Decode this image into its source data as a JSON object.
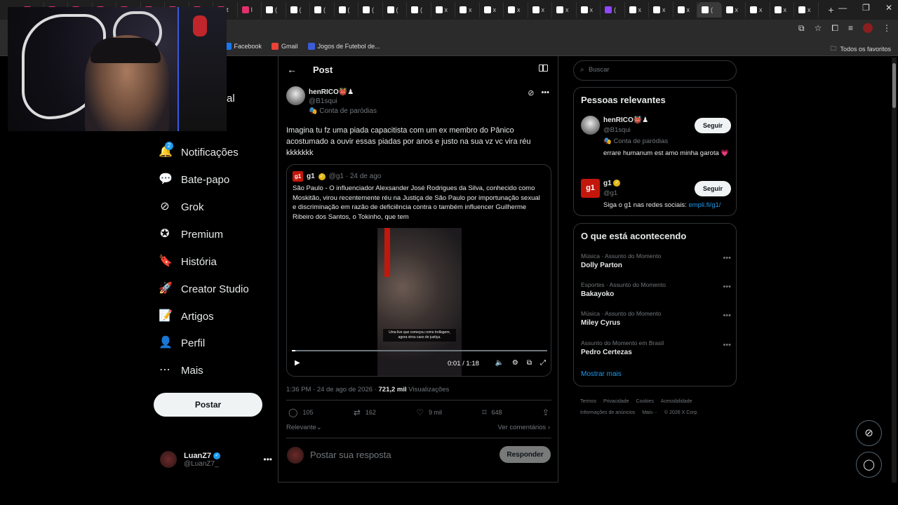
{
  "browser": {
    "tabs": [
      {
        "label": "t",
        "icon": "instagram-icon",
        "color": "#e1306c"
      },
      {
        "label": "t",
        "icon": "instagram-icon",
        "color": "#e1306c"
      },
      {
        "label": "t",
        "icon": "instagram-icon",
        "color": "#e1306c"
      },
      {
        "label": "t",
        "icon": "instagram-icon",
        "color": "#e1306c"
      },
      {
        "label": "t",
        "icon": "instagram-icon",
        "color": "#e1306c"
      },
      {
        "label": "t",
        "icon": "instagram-icon",
        "color": "#e1306c"
      },
      {
        "label": "t",
        "icon": "instagram-icon",
        "color": "#e1306c"
      },
      {
        "label": "t",
        "icon": "instagram-icon",
        "color": "#e1306c"
      },
      {
        "label": "t",
        "icon": "instagram-icon",
        "color": "#e1306c"
      },
      {
        "label": "I",
        "icon": "instagram-icon",
        "color": "#e1306c"
      },
      {
        "label": "(",
        "icon": "tiktok-icon",
        "color": "#ffffff"
      },
      {
        "label": "(",
        "icon": "tiktok-icon",
        "color": "#ffffff"
      },
      {
        "label": "(",
        "icon": "tiktok-icon",
        "color": "#ffffff"
      },
      {
        "label": "(",
        "icon": "tiktok-icon",
        "color": "#ffffff"
      },
      {
        "label": "(",
        "icon": "tiktok-icon",
        "color": "#ffffff"
      },
      {
        "label": "(",
        "icon": "tiktok-icon",
        "color": "#ffffff"
      },
      {
        "label": "(",
        "icon": "tiktok-icon",
        "color": "#ffffff"
      },
      {
        "label": "x",
        "icon": "x-icon",
        "color": "#ffffff"
      },
      {
        "label": "x",
        "icon": "x-icon",
        "color": "#ffffff"
      },
      {
        "label": "x",
        "icon": "x-icon",
        "color": "#ffffff"
      },
      {
        "label": "x",
        "icon": "x-icon",
        "color": "#ffffff"
      },
      {
        "label": "x",
        "icon": "x-icon",
        "color": "#ffffff"
      },
      {
        "label": "x",
        "icon": "x-icon",
        "color": "#ffffff"
      },
      {
        "label": "x",
        "icon": "x-icon",
        "color": "#ffffff"
      },
      {
        "label": "(",
        "icon": "twitch-icon",
        "color": "#9146ff"
      },
      {
        "label": "x",
        "icon": "x-icon",
        "color": "#ffffff"
      },
      {
        "label": "x",
        "icon": "x-icon",
        "color": "#ffffff"
      },
      {
        "label": "x",
        "icon": "x-icon",
        "color": "#ffffff"
      },
      {
        "label": "(",
        "icon": "x-icon",
        "color": "#ffffff",
        "active": true
      },
      {
        "label": "x",
        "icon": "x-icon",
        "color": "#ffffff"
      },
      {
        "label": "x",
        "icon": "x-icon",
        "color": "#ffffff"
      },
      {
        "label": "x",
        "icon": "x-icon",
        "color": "#ffffff"
      },
      {
        "label": "x",
        "icon": "x-icon",
        "color": "#ffffff"
      }
    ],
    "new_tab": "+",
    "bookmarks": [
      {
        "label": "ok",
        "color": "#1877f2"
      },
      {
        "label": "Facebook",
        "color": "#1877f2"
      },
      {
        "label": "Gmail",
        "color": "#ea4335"
      },
      {
        "label": "Jogos de Futebol de...",
        "color": "#3b5bdb"
      }
    ],
    "all_bookmarks": "Todos os favoritos"
  },
  "nav": {
    "partial_label": "al",
    "items": [
      {
        "label": "Notificações",
        "icon": "bell-icon",
        "glyph": "🔔",
        "badge": "2"
      },
      {
        "label": "Bate-papo",
        "icon": "chat-icon",
        "glyph": "💬"
      },
      {
        "label": "Grok",
        "icon": "grok-icon",
        "glyph": "⊘"
      },
      {
        "label": "Premium",
        "icon": "premium-icon",
        "glyph": "✪"
      },
      {
        "label": "História",
        "icon": "bookmark-icon",
        "glyph": "🔖"
      },
      {
        "label": "Creator Studio",
        "icon": "rocket-icon",
        "glyph": "🚀"
      },
      {
        "label": "Artigos",
        "icon": "article-icon",
        "glyph": "📝"
      },
      {
        "label": "Perfil",
        "icon": "person-icon",
        "glyph": "👤"
      },
      {
        "label": "Mais",
        "icon": "more-circle-icon",
        "glyph": "⋯"
      }
    ],
    "post_button": "Postar",
    "me": {
      "name": "LuanZ7",
      "handle": "@LuanZ7_"
    }
  },
  "main": {
    "title": "Post",
    "post": {
      "author_name": "henRICO👹♟",
      "author_handle": "@B1squi",
      "author_tag": "Conta de paródias",
      "text": "Imagina tu fz uma piada capacitista com um ex membro do Pânico acostumado a ouvir essas piadas por anos e justo na sua vz vc vira réu kkkkkkk",
      "quote": {
        "name": "g1",
        "meta": "@g1 · 24 de ago",
        "text": "São Paulo - O influenciador Alexsander José Rodrigues da Silva, conhecido como Moskitão, virou recentemente réu na Justiça de São Paulo por importunação sexual e discriminação em razão de deficiência contra o também influencer Guilherme Ribeiro dos Santos, o Tokinho, que tem",
        "video_caption": "Uma live que começou como trollagem, agora virou caso de justiça.",
        "time": "0:01 / 1:18",
        "progress": 0.013
      },
      "timestamp": "1:36 PM · 24 de ago de 2026 · ",
      "views_count": "721,2 mil",
      "views_label": " Visualizações",
      "stats": {
        "replies": "105",
        "reposts": "162",
        "likes": "9 mil",
        "bookmarks": "648"
      },
      "sort_label": "Relevante",
      "view_comments": "Ver comentários"
    },
    "reply": {
      "placeholder": "Postar sua resposta",
      "button": "Responder"
    }
  },
  "sidebar": {
    "search_placeholder": "Buscar",
    "people_title": "Pessoas relevantes",
    "people": [
      {
        "name": "henRICO👹♟",
        "handle": "@B1squi",
        "tag": "Conta de paródias",
        "bio": "errare humanum est amo minha garota 💗",
        "follow": "Seguir"
      },
      {
        "name": "g1",
        "handle": "@g1",
        "bio_text": "Siga o g1 nas redes sociais: ",
        "bio_link": "empli.fi/g1/",
        "follow": "Seguir"
      }
    ],
    "trends_title": "O que está acontecendo",
    "trends": [
      {
        "meta": "Música · Assunto do Momento",
        "name": "Dolly Parton"
      },
      {
        "meta": "Esportes · Assunto do Momento",
        "name": "Bakayoko"
      },
      {
        "meta": "Música · Assunto do Momento",
        "name": "Miley Cyrus"
      },
      {
        "meta": "Assunto do Momento em Brasil",
        "name": "Pedro Certezas"
      }
    ],
    "show_more": "Mostrar mais",
    "footer": [
      "Termos",
      "Privacidade",
      "Cookies",
      "Acessibilidade",
      "Informações de anúncios",
      "Mais···",
      "© 2026 X Corp."
    ]
  }
}
